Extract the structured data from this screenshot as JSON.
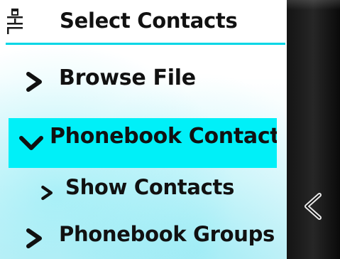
{
  "header": {
    "title": "Select Contacts",
    "icon": "contact-filter-icon"
  },
  "menu": {
    "items": [
      {
        "label": "Browse File",
        "icon": "chevron-right-icon",
        "selected": false,
        "level": 0
      },
      {
        "label": "Phonebook Contacts",
        "icon": "chevron-down-icon",
        "selected": true,
        "level": 0
      },
      {
        "label": "Show Contacts",
        "icon": "chevron-right-icon",
        "selected": false,
        "level": 1
      },
      {
        "label": "Phonebook Groups",
        "icon": "chevron-right-icon",
        "selected": false,
        "level": 0
      }
    ]
  },
  "side_panel": {
    "back_icon": "chevron-left-icon"
  },
  "colors": {
    "accent": "#00f0f8",
    "divider": "#00d6e6",
    "text": "#111111",
    "side_panel": "#1a1a1a"
  }
}
